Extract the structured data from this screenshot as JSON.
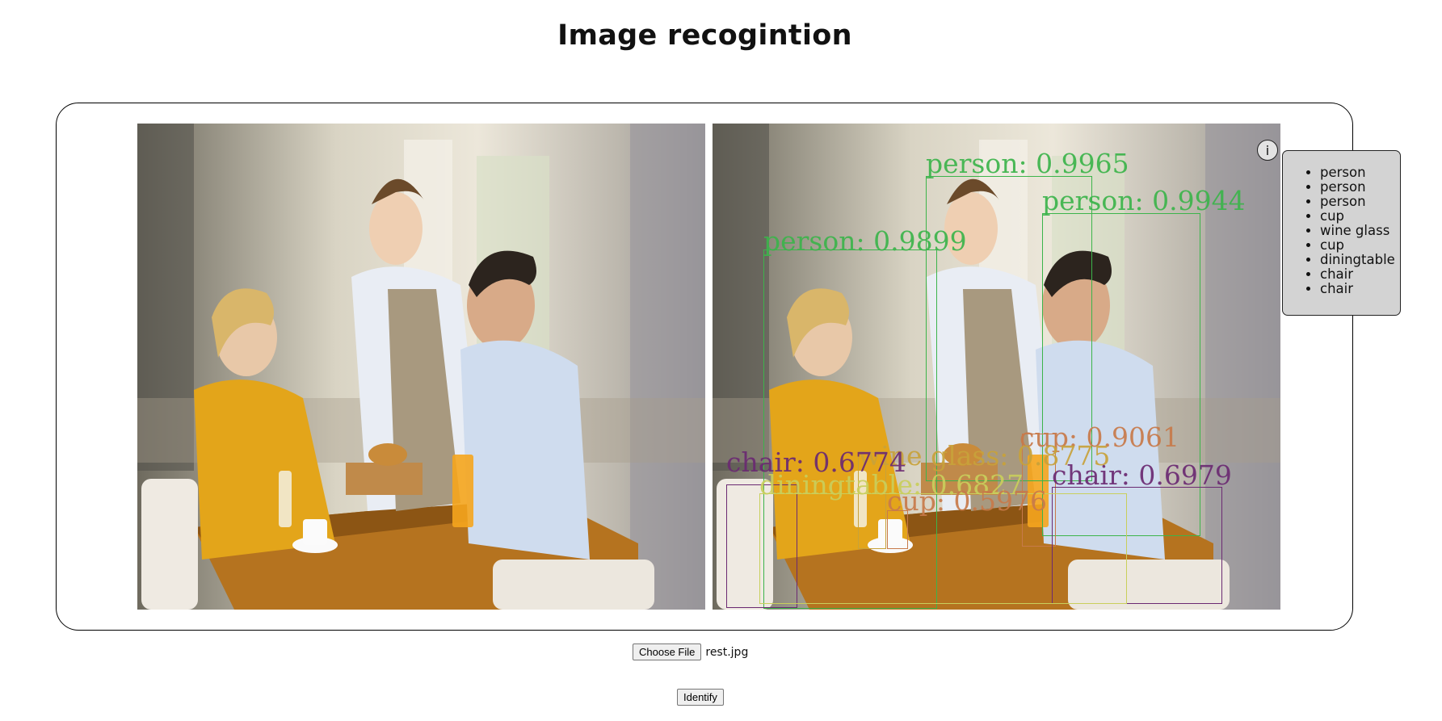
{
  "page": {
    "title": "Image recogintion"
  },
  "file_input": {
    "button_label": "Choose File",
    "file_name": "rest.jpg"
  },
  "actions": {
    "identify_label": "Identify"
  },
  "info_button": {
    "label": "i"
  },
  "detected_objects": [
    "person",
    "person",
    "person",
    "cup",
    "wine glass",
    "cup",
    "diningtable",
    "chair",
    "chair"
  ],
  "detections": [
    {
      "label": "person: 0.9965",
      "color": "#3cb44b"
    },
    {
      "label": "person: 0.9944",
      "color": "#3cb44b"
    },
    {
      "label": "person: 0.9899",
      "color": "#3cb44b"
    },
    {
      "label": "cup: 0.9061",
      "color": "#c87a4a"
    },
    {
      "label": "wine glass: 0.8775",
      "color": "#c8a23a"
    },
    {
      "label": "chair: 0.6774",
      "color": "#6b2a72"
    },
    {
      "label": "chair: 0.6979",
      "color": "#6b2a72"
    },
    {
      "label": "diningtable: 0.6827",
      "color": "#c9cf5c"
    },
    {
      "label": "cup: 0.5976",
      "color": "#c87a4a"
    }
  ]
}
